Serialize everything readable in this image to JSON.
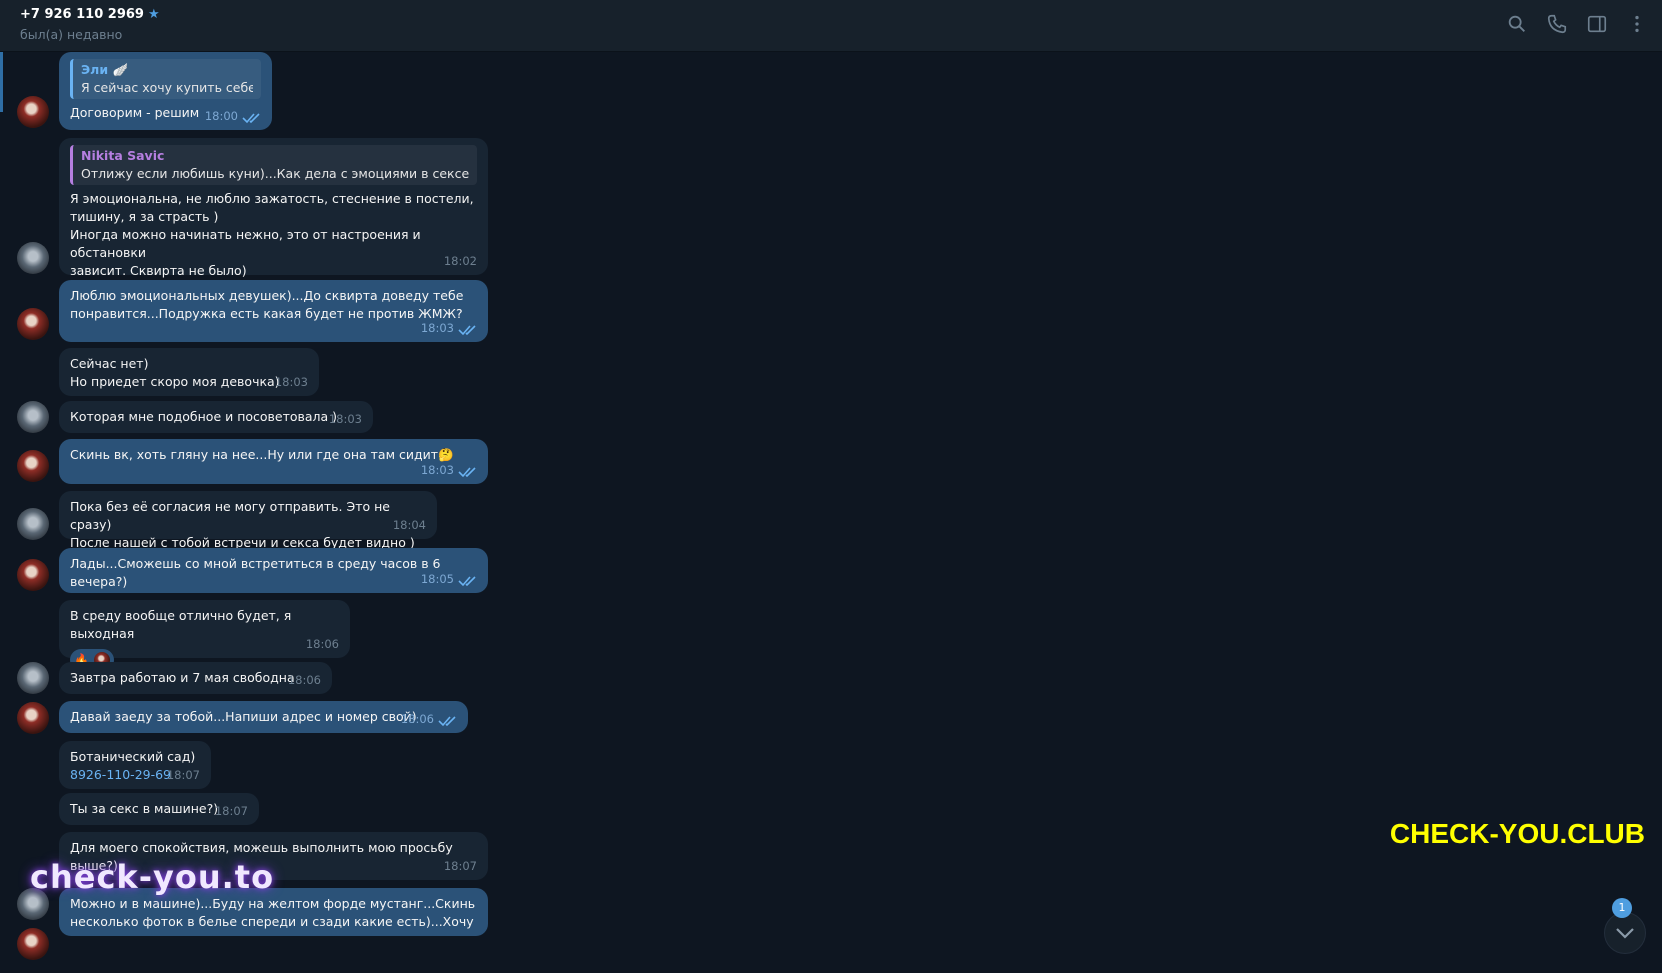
{
  "header": {
    "title": "+7 926 110 2969",
    "status": "был(а) недавно"
  },
  "messages": [
    {
      "dir": "out",
      "reply_name": "Эли 🪽",
      "reply_text": "Я сейчас хочу купить себе...",
      "text": "Договорим - решим",
      "time": "18:00"
    },
    {
      "dir": "in",
      "reply_name": "Nikita Savic",
      "reply_text": "Отлижу если любишь куни)...Как дела с эмоциями в сексе,кр...",
      "text": "Я эмоциональна, не люблю зажатость, стеснение в постели,\nтишину, я за страсть )\nИногда можно начинать нежно, это от настроения и обстановки\nзависит. Сквирта не было)\nЖмж интересно, о мжм даже не думала пока",
      "time": "18:02"
    },
    {
      "dir": "out",
      "text": "Люблю эмоциональных девушек)...До сквирта доведу тебе\nпонравится...Подружка есть какая будет не против ЖМЖ?",
      "time": "18:03"
    },
    {
      "dir": "in",
      "text": "Сейчас нет)\nНо приедет скоро моя девочка)",
      "time": "18:03"
    },
    {
      "dir": "in",
      "text": "Которая мне подобное и посоветовала )",
      "time": "18:03"
    },
    {
      "dir": "out",
      "text": "Скинь вк, хоть гляну на нее...Ну или где она там сидит🤔",
      "time": "18:03"
    },
    {
      "dir": "in",
      "text": "Пока без её согласия не могу отправить. Это не сразу)\nПосле нашей с тобой встречи и секса будет видно )",
      "time": "18:04"
    },
    {
      "dir": "out",
      "text": "Лады...Сможешь со мной встретиться в среду часов в 6 вечера?)",
      "time": "18:05"
    },
    {
      "dir": "in",
      "text": "В среду вообще отлично будет, я выходная",
      "time": "18:06",
      "reaction": "🔥"
    },
    {
      "dir": "in",
      "text": "Завтра работаю и 7 мая свободна",
      "time": "18:06"
    },
    {
      "dir": "out",
      "text": "Давай заеду за тобой...Напиши адрес и номер свой)",
      "time": "18:06"
    },
    {
      "dir": "in",
      "text": "Ботанический сад)",
      "link": "8926-110-29-69",
      "time": "18:07"
    },
    {
      "dir": "in",
      "text": "Ты за секс в машине?)",
      "time": "18:07"
    },
    {
      "dir": "in",
      "text": "Для моего спокойствия, можешь выполнить мою просьбу\nвыше?)",
      "time": "18:07"
    },
    {
      "dir": "out",
      "text": "Можно и в машине)...Буду на желтом форде мустанг...Скинь\nнесколько фоток в белье спереди и сзади какие есть)...Хочу на",
      "time": ""
    }
  ],
  "watermarks": {
    "left": "check-you.to",
    "right": "CHECK-YOU.CLUB"
  },
  "scroll_badge": "1",
  "icons": [
    "search-icon",
    "phone-icon",
    "sidebar-toggle-icon",
    "more-vertical-icon",
    "double-check-icon",
    "chevron-down-icon"
  ],
  "colors": {
    "background": "#0e1621",
    "incoming": "#182533",
    "outgoing": "#2b5278",
    "accent": "#6ab3f3"
  }
}
